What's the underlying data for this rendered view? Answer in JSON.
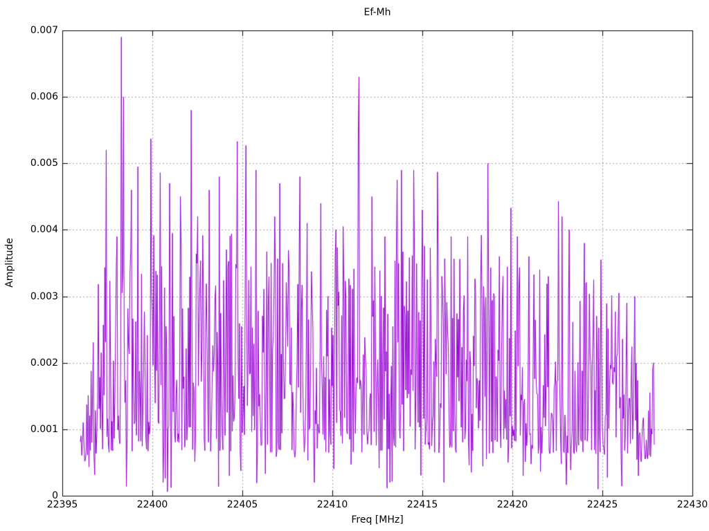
{
  "figure": {
    "title": "Ef-Mh",
    "xlabel": "Freq [MHz]",
    "ylabel": "Amplitude"
  },
  "chart_data": {
    "type": "line",
    "title": "Ef-Mh",
    "xlabel": "Freq [MHz]",
    "ylabel": "Amplitude",
    "xlim": [
      22395,
      22430
    ],
    "ylim": [
      0,
      0.007
    ],
    "xticks": [
      22395,
      22400,
      22405,
      22410,
      22415,
      22420,
      22425,
      22430
    ],
    "xtick_labels": [
      "22395",
      "22400",
      "22405",
      "22410",
      "22415",
      "22420",
      "22425",
      "22430"
    ],
    "yticks": [
      0,
      0.001,
      0.002,
      0.003,
      0.004,
      0.005,
      0.006,
      0.007
    ],
    "ytick_labels": [
      "0",
      "0.001",
      "0.002",
      "0.003",
      "0.004",
      "0.005",
      "0.006",
      "0.007"
    ],
    "grid": true,
    "legend": "none",
    "line_color": "#9400d3",
    "grid_color": "#9f9f9f",
    "axis_color": "#000000",
    "background": "#ffffff",
    "series": [
      {
        "name": "Ef-Mh",
        "x_start_mhz": 22396.0,
        "x_end_mhz": 22427.9,
        "sample_step_mhz": 0.04,
        "seed": 42,
        "noise_floor": 0.00045,
        "envelope": [
          [
            22396.0,
            0.0012
          ],
          [
            22396.5,
            0.002
          ],
          [
            22397.0,
            0.0032
          ],
          [
            22397.8,
            0.004
          ],
          [
            22399.0,
            0.004
          ],
          [
            22401.0,
            0.004
          ],
          [
            22403.0,
            0.004
          ],
          [
            22405.0,
            0.004
          ],
          [
            22407.0,
            0.0038
          ],
          [
            22409.0,
            0.0038
          ],
          [
            22411.0,
            0.0037
          ],
          [
            22413.0,
            0.0038
          ],
          [
            22415.0,
            0.0038
          ],
          [
            22417.0,
            0.0036
          ],
          [
            22419.0,
            0.0036
          ],
          [
            22421.0,
            0.0035
          ],
          [
            22423.0,
            0.0035
          ],
          [
            22424.5,
            0.0033
          ],
          [
            22426.0,
            0.0029
          ],
          [
            22427.0,
            0.0024
          ],
          [
            22427.6,
            0.0018
          ],
          [
            22427.9,
            0.002
          ]
        ],
        "peaks": [
          [
            22397.45,
            0.0052
          ],
          [
            22398.05,
            0.0039
          ],
          [
            22398.3,
            0.0069
          ],
          [
            22398.42,
            0.006
          ],
          [
            22398.85,
            0.0046
          ],
          [
            22399.2,
            0.00495
          ],
          [
            22399.9,
            0.00537
          ],
          [
            22400.45,
            0.00486
          ],
          [
            22400.95,
            0.0047
          ],
          [
            22401.55,
            0.0045
          ],
          [
            22402.15,
            0.0058
          ],
          [
            22402.5,
            0.0042
          ],
          [
            22403.15,
            0.0046
          ],
          [
            22403.7,
            0.0048
          ],
          [
            22404.73,
            0.00533
          ],
          [
            22405.2,
            0.00527
          ],
          [
            22405.77,
            0.0049
          ],
          [
            22406.8,
            0.0042
          ],
          [
            22407.1,
            0.0047
          ],
          [
            22408.2,
            0.0048
          ],
          [
            22408.6,
            0.0041
          ],
          [
            22409.35,
            0.0044
          ],
          [
            22410.2,
            0.004
          ],
          [
            22410.6,
            0.00405
          ],
          [
            22411.44,
            0.00545
          ],
          [
            22411.48,
            0.0063
          ],
          [
            22412.2,
            0.0045
          ],
          [
            22412.9,
            0.0039
          ],
          [
            22413.6,
            0.00475
          ],
          [
            22413.85,
            0.0049
          ],
          [
            22414.5,
            0.0049
          ],
          [
            22415.0,
            0.0043
          ],
          [
            22415.85,
            0.00487
          ],
          [
            22416.6,
            0.0039
          ],
          [
            22417.5,
            0.0039
          ],
          [
            22418.3,
            0.00392
          ],
          [
            22418.65,
            0.005
          ],
          [
            22419.3,
            0.0036
          ],
          [
            22419.9,
            0.00433
          ],
          [
            22420.3,
            0.0039
          ],
          [
            22420.9,
            0.0036
          ],
          [
            22421.5,
            0.0034
          ],
          [
            22422.0,
            0.0033
          ],
          [
            22422.55,
            0.00443
          ],
          [
            22422.75,
            0.0042
          ],
          [
            22423.15,
            0.004
          ],
          [
            22424.0,
            0.0038
          ],
          [
            22424.9,
            0.00355
          ],
          [
            22425.9,
            0.00305
          ],
          [
            22426.35,
            0.0029
          ],
          [
            22426.8,
            0.003
          ],
          [
            22427.85,
            0.002
          ]
        ],
        "nulls": [
          [
            22396.75,
            0.0006
          ],
          [
            22400.85,
            6e-05
          ],
          [
            22404.3,
            0.0003
          ],
          [
            22409.0,
            0.0002
          ],
          [
            22413.2,
            0.0002
          ],
          [
            22416.2,
            0.0002
          ],
          [
            22420.6,
            0.0003
          ],
          [
            22424.75,
            0.0001
          ],
          [
            22427.0,
            0.0003
          ]
        ]
      }
    ]
  }
}
